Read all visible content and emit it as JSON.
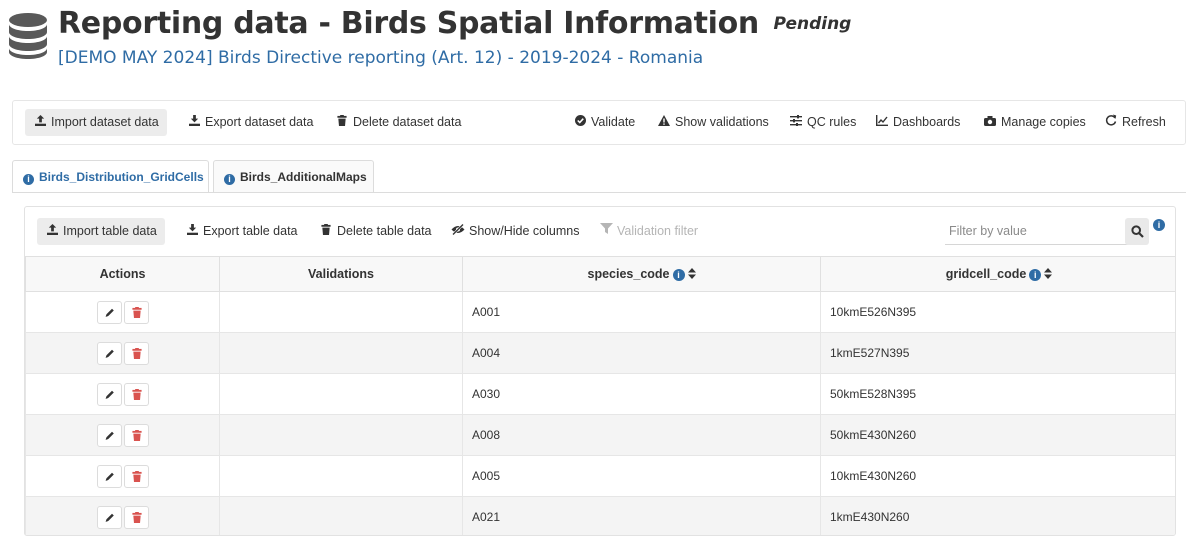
{
  "header": {
    "title": "Reporting data - Birds Spatial Information",
    "status": "Pending",
    "subtitle": "[DEMO MAY 2024] Birds Directive reporting (Art. 12) - 2019-2024 - Romania",
    "icon": "database-icon"
  },
  "toolbar": {
    "import": "Import dataset data",
    "export": "Export dataset data",
    "delete": "Delete dataset data",
    "validate": "Validate",
    "show_validations": "Show validations",
    "qc_rules": "QC rules",
    "dashboards": "Dashboards",
    "manage_copies": "Manage copies",
    "refresh": "Refresh"
  },
  "tabs": [
    {
      "label": "Birds_Distribution_GridCells",
      "active": true
    },
    {
      "label": "Birds_AdditionalMaps",
      "active": false
    }
  ],
  "table_toolbar": {
    "import": "Import table data",
    "export": "Export table data",
    "delete": "Delete table data",
    "show_hide": "Show/Hide columns",
    "validation_filter": "Validation filter",
    "filter_placeholder": "Filter by value"
  },
  "table": {
    "columns": [
      "Actions",
      "Validations",
      "species_code",
      "gridcell_code"
    ],
    "rows": [
      {
        "validations": "",
        "species_code": "A001",
        "gridcell_code": "10kmE526N395"
      },
      {
        "validations": "",
        "species_code": "A004",
        "gridcell_code": "1kmE527N395"
      },
      {
        "validations": "",
        "species_code": "A030",
        "gridcell_code": "50kmE528N395"
      },
      {
        "validations": "",
        "species_code": "A008",
        "gridcell_code": "50kmE430N260"
      },
      {
        "validations": "",
        "species_code": "A005",
        "gridcell_code": "10kmE430N260"
      },
      {
        "validations": "",
        "species_code": "A021",
        "gridcell_code": "1kmE430N260"
      }
    ]
  },
  "colors": {
    "accent": "#2f6ca5",
    "delete_red": "#d9534f",
    "text": "#333333"
  }
}
